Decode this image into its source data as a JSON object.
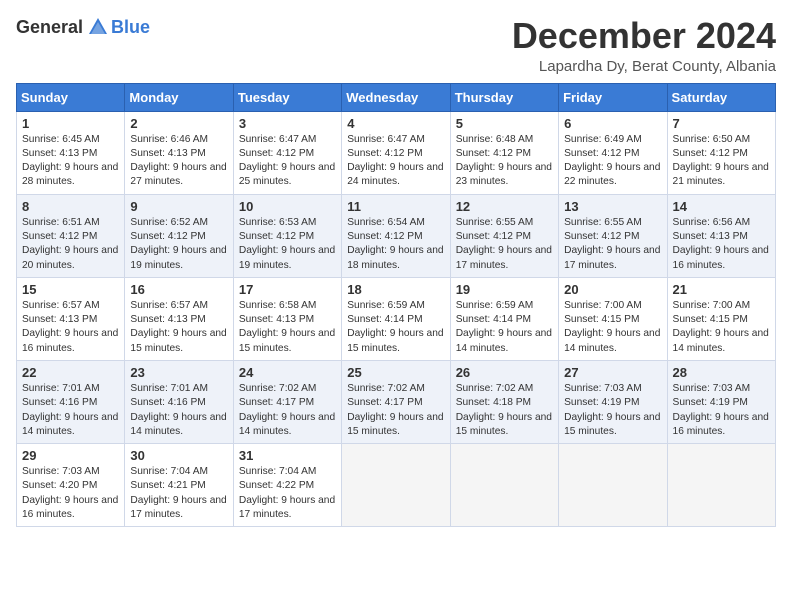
{
  "header": {
    "logo_general": "General",
    "logo_blue": "Blue",
    "month_title": "December 2024",
    "location": "Lapardha Dy, Berat County, Albania"
  },
  "weekdays": [
    "Sunday",
    "Monday",
    "Tuesday",
    "Wednesday",
    "Thursday",
    "Friday",
    "Saturday"
  ],
  "weeks": [
    [
      {
        "day": "1",
        "sunrise": "Sunrise: 6:45 AM",
        "sunset": "Sunset: 4:13 PM",
        "daylight": "Daylight: 9 hours and 28 minutes."
      },
      {
        "day": "2",
        "sunrise": "Sunrise: 6:46 AM",
        "sunset": "Sunset: 4:13 PM",
        "daylight": "Daylight: 9 hours and 27 minutes."
      },
      {
        "day": "3",
        "sunrise": "Sunrise: 6:47 AM",
        "sunset": "Sunset: 4:12 PM",
        "daylight": "Daylight: 9 hours and 25 minutes."
      },
      {
        "day": "4",
        "sunrise": "Sunrise: 6:47 AM",
        "sunset": "Sunset: 4:12 PM",
        "daylight": "Daylight: 9 hours and 24 minutes."
      },
      {
        "day": "5",
        "sunrise": "Sunrise: 6:48 AM",
        "sunset": "Sunset: 4:12 PM",
        "daylight": "Daylight: 9 hours and 23 minutes."
      },
      {
        "day": "6",
        "sunrise": "Sunrise: 6:49 AM",
        "sunset": "Sunset: 4:12 PM",
        "daylight": "Daylight: 9 hours and 22 minutes."
      },
      {
        "day": "7",
        "sunrise": "Sunrise: 6:50 AM",
        "sunset": "Sunset: 4:12 PM",
        "daylight": "Daylight: 9 hours and 21 minutes."
      }
    ],
    [
      {
        "day": "8",
        "sunrise": "Sunrise: 6:51 AM",
        "sunset": "Sunset: 4:12 PM",
        "daylight": "Daylight: 9 hours and 20 minutes."
      },
      {
        "day": "9",
        "sunrise": "Sunrise: 6:52 AM",
        "sunset": "Sunset: 4:12 PM",
        "daylight": "Daylight: 9 hours and 19 minutes."
      },
      {
        "day": "10",
        "sunrise": "Sunrise: 6:53 AM",
        "sunset": "Sunset: 4:12 PM",
        "daylight": "Daylight: 9 hours and 19 minutes."
      },
      {
        "day": "11",
        "sunrise": "Sunrise: 6:54 AM",
        "sunset": "Sunset: 4:12 PM",
        "daylight": "Daylight: 9 hours and 18 minutes."
      },
      {
        "day": "12",
        "sunrise": "Sunrise: 6:55 AM",
        "sunset": "Sunset: 4:12 PM",
        "daylight": "Daylight: 9 hours and 17 minutes."
      },
      {
        "day": "13",
        "sunrise": "Sunrise: 6:55 AM",
        "sunset": "Sunset: 4:12 PM",
        "daylight": "Daylight: 9 hours and 17 minutes."
      },
      {
        "day": "14",
        "sunrise": "Sunrise: 6:56 AM",
        "sunset": "Sunset: 4:13 PM",
        "daylight": "Daylight: 9 hours and 16 minutes."
      }
    ],
    [
      {
        "day": "15",
        "sunrise": "Sunrise: 6:57 AM",
        "sunset": "Sunset: 4:13 PM",
        "daylight": "Daylight: 9 hours and 16 minutes."
      },
      {
        "day": "16",
        "sunrise": "Sunrise: 6:57 AM",
        "sunset": "Sunset: 4:13 PM",
        "daylight": "Daylight: 9 hours and 15 minutes."
      },
      {
        "day": "17",
        "sunrise": "Sunrise: 6:58 AM",
        "sunset": "Sunset: 4:13 PM",
        "daylight": "Daylight: 9 hours and 15 minutes."
      },
      {
        "day": "18",
        "sunrise": "Sunrise: 6:59 AM",
        "sunset": "Sunset: 4:14 PM",
        "daylight": "Daylight: 9 hours and 15 minutes."
      },
      {
        "day": "19",
        "sunrise": "Sunrise: 6:59 AM",
        "sunset": "Sunset: 4:14 PM",
        "daylight": "Daylight: 9 hours and 14 minutes."
      },
      {
        "day": "20",
        "sunrise": "Sunrise: 7:00 AM",
        "sunset": "Sunset: 4:15 PM",
        "daylight": "Daylight: 9 hours and 14 minutes."
      },
      {
        "day": "21",
        "sunrise": "Sunrise: 7:00 AM",
        "sunset": "Sunset: 4:15 PM",
        "daylight": "Daylight: 9 hours and 14 minutes."
      }
    ],
    [
      {
        "day": "22",
        "sunrise": "Sunrise: 7:01 AM",
        "sunset": "Sunset: 4:16 PM",
        "daylight": "Daylight: 9 hours and 14 minutes."
      },
      {
        "day": "23",
        "sunrise": "Sunrise: 7:01 AM",
        "sunset": "Sunset: 4:16 PM",
        "daylight": "Daylight: 9 hours and 14 minutes."
      },
      {
        "day": "24",
        "sunrise": "Sunrise: 7:02 AM",
        "sunset": "Sunset: 4:17 PM",
        "daylight": "Daylight: 9 hours and 14 minutes."
      },
      {
        "day": "25",
        "sunrise": "Sunrise: 7:02 AM",
        "sunset": "Sunset: 4:17 PM",
        "daylight": "Daylight: 9 hours and 15 minutes."
      },
      {
        "day": "26",
        "sunrise": "Sunrise: 7:02 AM",
        "sunset": "Sunset: 4:18 PM",
        "daylight": "Daylight: 9 hours and 15 minutes."
      },
      {
        "day": "27",
        "sunrise": "Sunrise: 7:03 AM",
        "sunset": "Sunset: 4:19 PM",
        "daylight": "Daylight: 9 hours and 15 minutes."
      },
      {
        "day": "28",
        "sunrise": "Sunrise: 7:03 AM",
        "sunset": "Sunset: 4:19 PM",
        "daylight": "Daylight: 9 hours and 16 minutes."
      }
    ],
    [
      {
        "day": "29",
        "sunrise": "Sunrise: 7:03 AM",
        "sunset": "Sunset: 4:20 PM",
        "daylight": "Daylight: 9 hours and 16 minutes."
      },
      {
        "day": "30",
        "sunrise": "Sunrise: 7:04 AM",
        "sunset": "Sunset: 4:21 PM",
        "daylight": "Daylight: 9 hours and 17 minutes."
      },
      {
        "day": "31",
        "sunrise": "Sunrise: 7:04 AM",
        "sunset": "Sunset: 4:22 PM",
        "daylight": "Daylight: 9 hours and 17 minutes."
      },
      null,
      null,
      null,
      null
    ]
  ]
}
